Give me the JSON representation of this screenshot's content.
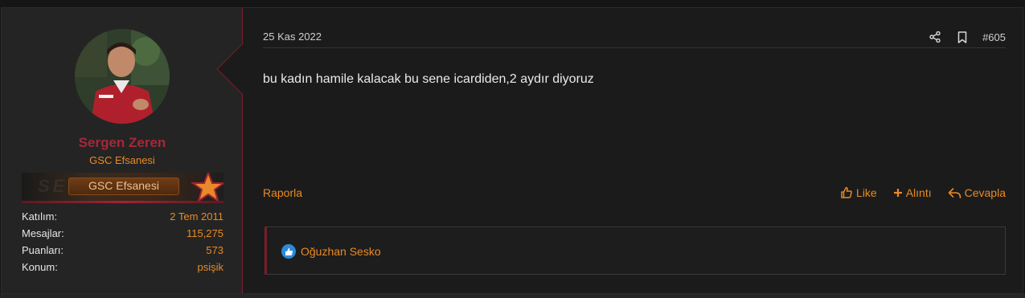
{
  "user": {
    "name": "Sergen Zeren",
    "title": "GSC Efsanesi",
    "banner_label": "GSC Efsanesi",
    "banner_bg_text": "SENSEI",
    "stats": [
      {
        "label": "Katılım:",
        "value": "2 Tem 2011"
      },
      {
        "label": "Mesajlar:",
        "value": "115,275"
      },
      {
        "label": "Puanları:",
        "value": "573"
      },
      {
        "label": "Konum:",
        "value": "psişik"
      }
    ]
  },
  "post": {
    "date": "25 Kas 2022",
    "number": "#605",
    "message": "bu kadın hamile kalacak bu sene icardiden,2 aydır diyoruz",
    "report_label": "Raporla",
    "actions": {
      "like": "Like",
      "quote": "Alıntı",
      "reply": "Cevapla"
    },
    "reaction_user": "Oğuzhan Sesko"
  },
  "colors": {
    "accent": "#e88a24",
    "brand_red": "#a5283a",
    "background": "#1b1b1b",
    "sidebar": "#242424",
    "like_badge": "#2d8ad8"
  },
  "icons": {
    "share": "share-icon",
    "bookmark": "bookmark-icon",
    "like": "thumbs-up-icon",
    "quote": "plus-icon",
    "reply": "reply-icon",
    "reaction": "like-reaction-icon"
  }
}
